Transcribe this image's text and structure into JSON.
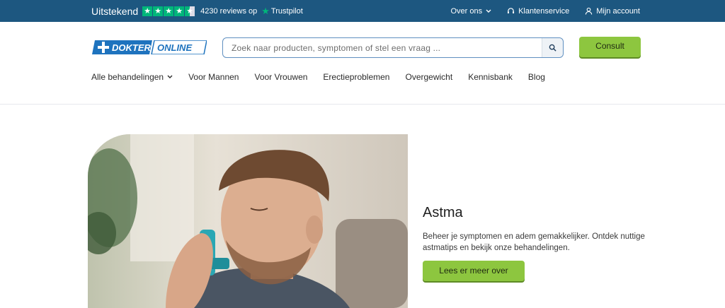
{
  "topbar": {
    "rating_label": "Uitstekend",
    "reviews_text": "4230 reviews op",
    "trustpilot_label": "Trustpilot",
    "links": {
      "about": "Over ons",
      "service": "Klantenservice",
      "account": "Mijn account"
    }
  },
  "header": {
    "logo_text": "DOKTER ONLINE",
    "search_placeholder": "Zoek naar producten, symptomen of stel een vraag ...",
    "consult_label": "Consult"
  },
  "nav": {
    "items": [
      "Alle behandelingen",
      "Voor Mannen",
      "Voor Vrouwen",
      "Erectieproblemen",
      "Overgewicht",
      "Kennisbank",
      "Blog"
    ]
  },
  "hero": {
    "title": "Astma",
    "text": "Beheer je symptomen en adem gemakkelijker. Ontdek nuttige astmatips en bekijk onze behandelingen.",
    "button_label": "Lees er meer over"
  },
  "colors": {
    "topbar_bg": "#1d5780",
    "accent_green": "#8dc63f",
    "trustpilot_green": "#00b67a",
    "logo_blue": "#1e73be"
  }
}
